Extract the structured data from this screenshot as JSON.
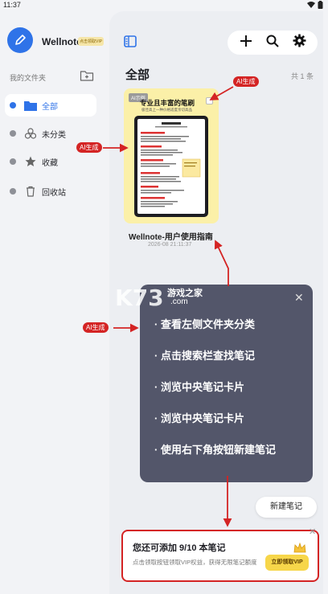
{
  "status_bar": {
    "time": "11:37"
  },
  "sidebar": {
    "app_name": "Wellnote",
    "vip_badge": "点击领取VIP",
    "folders_title": "我的文件夹",
    "items": [
      {
        "label": "全部",
        "icon": "folder-icon",
        "active": true
      },
      {
        "label": "未分类",
        "icon": "uncategorized-icon",
        "active": false
      },
      {
        "label": "收藏",
        "icon": "star-icon",
        "active": false
      },
      {
        "label": "回收站",
        "icon": "trash-icon",
        "active": false
      }
    ]
  },
  "toolbar": {
    "icons": [
      "plus-icon",
      "search-icon",
      "gear-icon"
    ]
  },
  "main": {
    "title": "全部",
    "total": "共 1 条",
    "note": {
      "tag": "AI示例",
      "headline": "专业且丰富的笔刷",
      "subline": "极佳高上一种价格适度亲切高品",
      "title": "Wellnote-用户使用指南",
      "date": "2026-08 21:11:37"
    }
  },
  "watermark": {
    "text": "游戏之家",
    "com": ".com"
  },
  "tip_popup": {
    "lines": [
      "· 查看左侧文件夹分类",
      "· 点击搜索栏查找笔记",
      "· 浏览中央笔记卡片",
      "· 浏览中央笔记卡片",
      "· 使用右下角按钮新建笔记"
    ]
  },
  "ai_label": "AI生成",
  "new_note_button": "新建笔记",
  "quota_banner": {
    "title": "您还可添加 9/10 本笔记",
    "description": "点击领取按钮领取VIP权益，获得无限笔记额度",
    "button": "立即领取VIP"
  },
  "colors": {
    "accent": "#2f73e8",
    "annotation": "#d42424",
    "popup": "#53566a",
    "card": "#fbf0a8"
  }
}
